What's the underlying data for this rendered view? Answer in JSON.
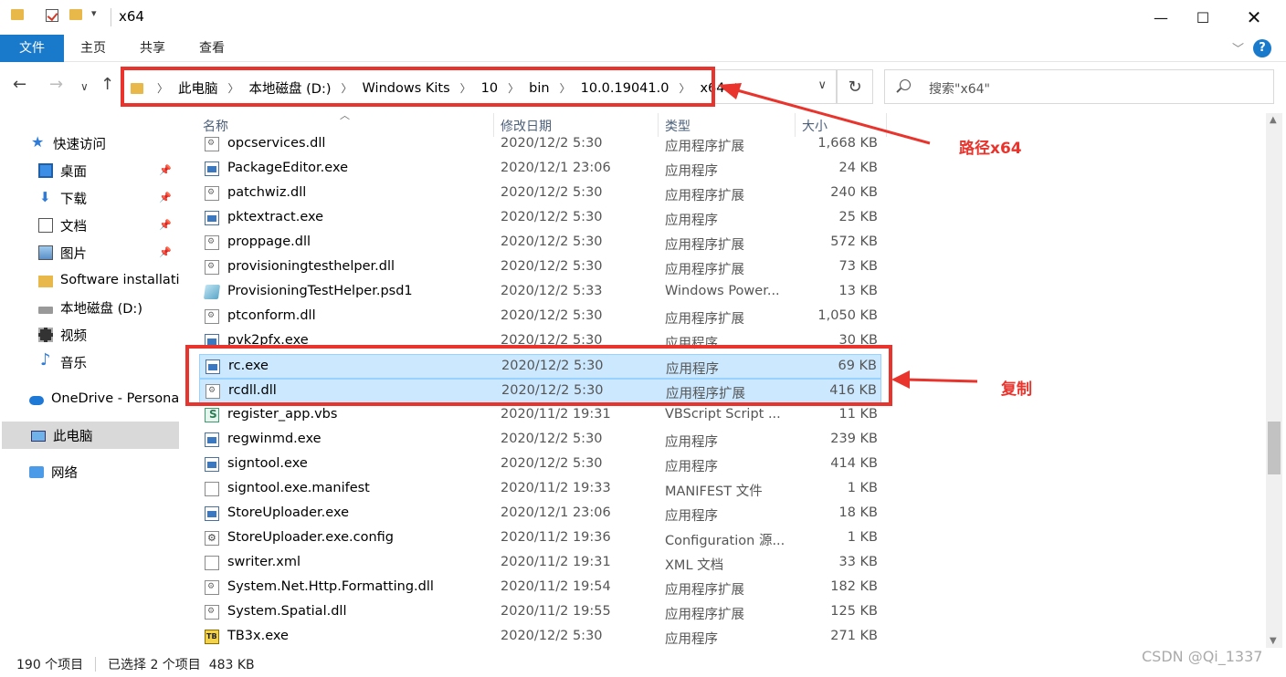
{
  "window": {
    "title": "x64"
  },
  "ribbon": {
    "tabs": [
      "文件",
      "主页",
      "共享",
      "查看"
    ],
    "help": "?"
  },
  "address": {
    "crumbs": [
      "此电脑",
      "本地磁盘 (D:)",
      "Windows Kits",
      "10",
      "bin",
      "10.0.19041.0",
      "x64"
    ]
  },
  "search": {
    "placeholder": "搜索\"x64\""
  },
  "nav": [
    {
      "label": "快速访问",
      "icon": "star-icon"
    },
    {
      "label": "桌面",
      "icon": "desktop-icon",
      "pinned": true
    },
    {
      "label": "下载",
      "icon": "download-icon",
      "pinned": true
    },
    {
      "label": "文档",
      "icon": "document-icon",
      "pinned": true
    },
    {
      "label": "图片",
      "icon": "picture-icon",
      "pinned": true
    },
    {
      "label": "Software installati",
      "icon": "folder-icon"
    },
    {
      "label": "本地磁盘 (D:)",
      "icon": "drive-icon"
    },
    {
      "label": "视频",
      "icon": "video-icon"
    },
    {
      "label": "音乐",
      "icon": "music-icon"
    },
    {
      "label": "OneDrive - Persona",
      "icon": "cloud-icon"
    },
    {
      "label": "此电脑",
      "icon": "computer-icon",
      "selected": true
    },
    {
      "label": "网络",
      "icon": "network-icon"
    }
  ],
  "columns": {
    "name": "名称",
    "date": "修改日期",
    "type": "类型",
    "size": "大小"
  },
  "files": [
    {
      "name": "opcservices.dll",
      "date": "2020/12/2 5:30",
      "type": "应用程序扩展",
      "size": "1,668 KB",
      "icon": "dll"
    },
    {
      "name": "PackageEditor.exe",
      "date": "2020/12/1 23:06",
      "type": "应用程序",
      "size": "24 KB",
      "icon": "exe"
    },
    {
      "name": "patchwiz.dll",
      "date": "2020/12/2 5:30",
      "type": "应用程序扩展",
      "size": "240 KB",
      "icon": "dll"
    },
    {
      "name": "pktextract.exe",
      "date": "2020/12/2 5:30",
      "type": "应用程序",
      "size": "25 KB",
      "icon": "exe"
    },
    {
      "name": "proppage.dll",
      "date": "2020/12/2 5:30",
      "type": "应用程序扩展",
      "size": "572 KB",
      "icon": "dll"
    },
    {
      "name": "provisioningtesthelper.dll",
      "date": "2020/12/2 5:30",
      "type": "应用程序扩展",
      "size": "73 KB",
      "icon": "dll"
    },
    {
      "name": "ProvisioningTestHelper.psd1",
      "date": "2020/12/2 5:33",
      "type": "Windows Power...",
      "size": "13 KB",
      "icon": "ps"
    },
    {
      "name": "ptconform.dll",
      "date": "2020/12/2 5:30",
      "type": "应用程序扩展",
      "size": "1,050 KB",
      "icon": "dll"
    },
    {
      "name": "pvk2pfx.exe",
      "date": "2020/12/2 5:30",
      "type": "应用程序",
      "size": "30 KB",
      "icon": "exe"
    },
    {
      "name": "rc.exe",
      "date": "2020/12/2 5:30",
      "type": "应用程序",
      "size": "69 KB",
      "icon": "exe",
      "selected": true
    },
    {
      "name": "rcdll.dll",
      "date": "2020/12/2 5:30",
      "type": "应用程序扩展",
      "size": "416 KB",
      "icon": "dll",
      "selected": true
    },
    {
      "name": "register_app.vbs",
      "date": "2020/11/2 19:31",
      "type": "VBScript Script ...",
      "size": "11 KB",
      "icon": "vbs"
    },
    {
      "name": "regwinmd.exe",
      "date": "2020/12/2 5:30",
      "type": "应用程序",
      "size": "239 KB",
      "icon": "exe"
    },
    {
      "name": "signtool.exe",
      "date": "2020/12/2 5:30",
      "type": "应用程序",
      "size": "414 KB",
      "icon": "exe"
    },
    {
      "name": "signtool.exe.manifest",
      "date": "2020/11/2 19:33",
      "type": "MANIFEST 文件",
      "size": "1 KB",
      "icon": "txt"
    },
    {
      "name": "StoreUploader.exe",
      "date": "2020/12/1 23:06",
      "type": "应用程序",
      "size": "18 KB",
      "icon": "exe"
    },
    {
      "name": "StoreUploader.exe.config",
      "date": "2020/11/2 19:36",
      "type": "Configuration 源...",
      "size": "1 KB",
      "icon": "cfg"
    },
    {
      "name": "swriter.xml",
      "date": "2020/11/2 19:31",
      "type": "XML 文档",
      "size": "33 KB",
      "icon": "txt"
    },
    {
      "name": "System.Net.Http.Formatting.dll",
      "date": "2020/11/2 19:54",
      "type": "应用程序扩展",
      "size": "182 KB",
      "icon": "dll"
    },
    {
      "name": "System.Spatial.dll",
      "date": "2020/11/2 19:55",
      "type": "应用程序扩展",
      "size": "125 KB",
      "icon": "dll"
    },
    {
      "name": "TB3x.exe",
      "date": "2020/12/2 5:30",
      "type": "应用程序",
      "size": "271 KB",
      "icon": "tb3"
    }
  ],
  "status": {
    "count": "190 个项目",
    "selection": "已选择 2 个项目  483 KB"
  },
  "annotations": {
    "path_label": "路径x64",
    "copy_label": "复制"
  },
  "watermark": "CSDN @Qi_1337"
}
